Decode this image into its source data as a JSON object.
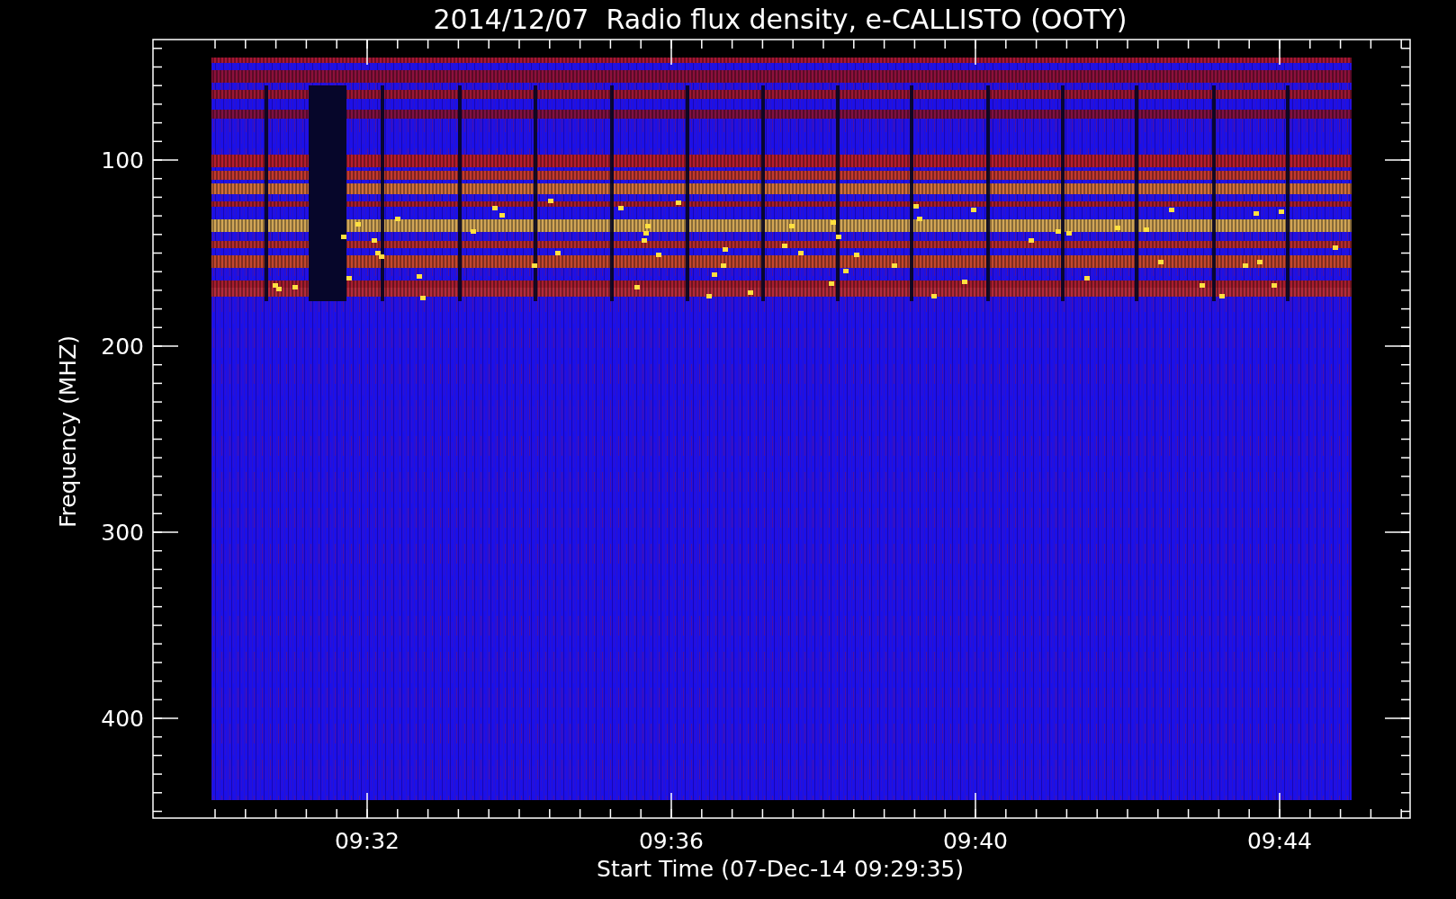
{
  "title": "2014/12/07  Radio flux density, e-CALLISTO (OOTY)",
  "y_axis": {
    "label": "Frequency (MHZ)",
    "ticks": [
      "100",
      "200",
      "300",
      "400"
    ]
  },
  "x_axis": {
    "label": "Start Time (07-Dec-14 09:29:35)",
    "ticks": [
      "09:32",
      "09:36",
      "09:40",
      "09:44"
    ]
  }
}
